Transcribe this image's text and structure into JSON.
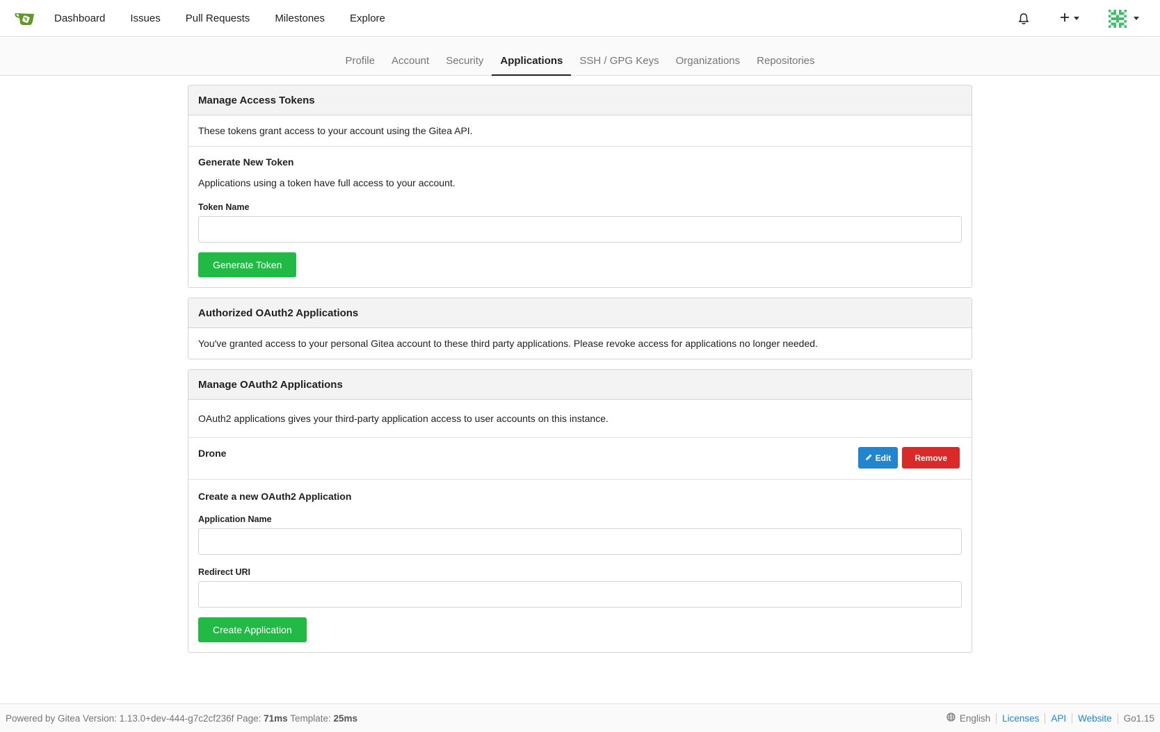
{
  "nav": {
    "items": [
      "Dashboard",
      "Issues",
      "Pull Requests",
      "Milestones",
      "Explore"
    ]
  },
  "tabs": {
    "items": [
      "Profile",
      "Account",
      "Security",
      "Applications",
      "SSH / GPG Keys",
      "Organizations",
      "Repositories"
    ],
    "active": "Applications"
  },
  "tokens": {
    "header": "Manage Access Tokens",
    "description": "These tokens grant access to your account using the Gitea API.",
    "generate_title": "Generate New Token",
    "generate_desc": "Applications using a token have full access to your account.",
    "token_name_label": "Token Name",
    "token_name_value": "",
    "generate_button": "Generate Token"
  },
  "authorized": {
    "header": "Authorized OAuth2 Applications",
    "description": "You've granted access to your personal Gitea account to these third party applications. Please revoke access for applications no longer needed."
  },
  "oauth": {
    "header": "Manage OAuth2 Applications",
    "description": "OAuth2 applications gives your third-party application access to user accounts on this instance.",
    "apps": [
      {
        "name": "Drone",
        "edit_label": "Edit",
        "remove_label": "Remove"
      }
    ],
    "create_title": "Create a new OAuth2 Application",
    "app_name_label": "Application Name",
    "app_name_value": "",
    "redirect_label": "Redirect URI",
    "redirect_value": "",
    "create_button": "Create Application"
  },
  "footer": {
    "powered": "Powered by Gitea Version: 1.13.0+dev-444-g7c2cf236f Page:",
    "page_time": "71ms",
    "template_label": "Template:",
    "template_time": "25ms",
    "language": "English",
    "links": [
      "Licenses",
      "API",
      "Website"
    ],
    "go_version": "Go1.15"
  },
  "colors": {
    "primary_green": "#21ba45",
    "edit_blue": "#2185d0",
    "remove_red": "#db2828",
    "logo_green": "#609926"
  }
}
